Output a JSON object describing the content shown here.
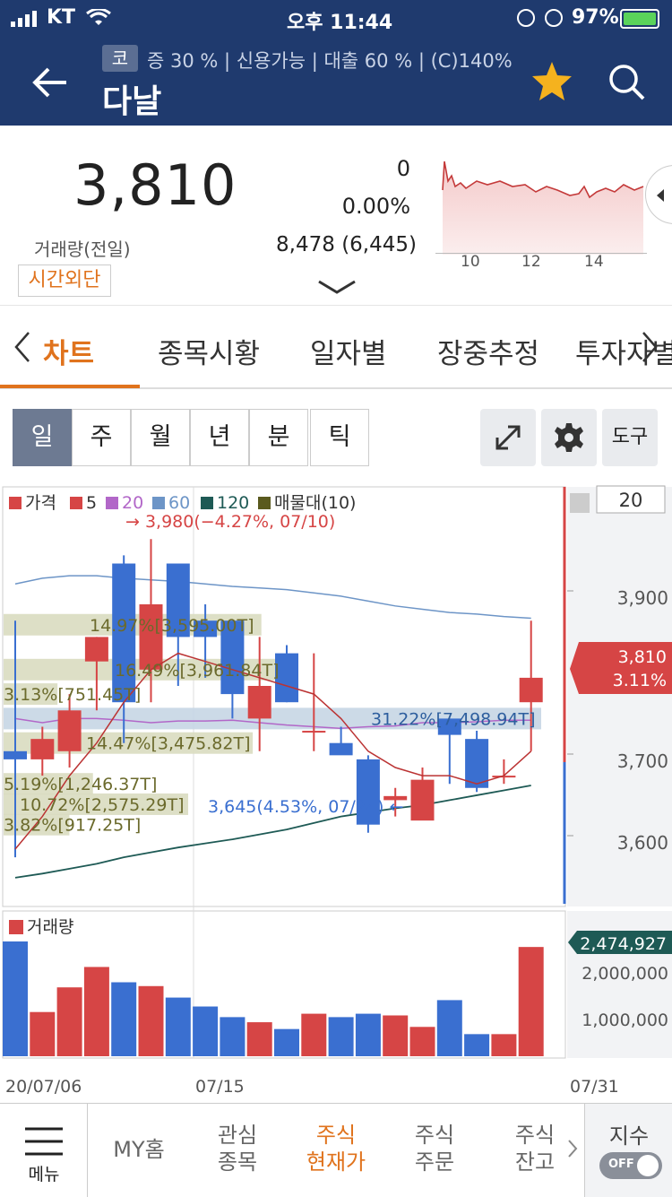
{
  "status": {
    "carrier": "KT",
    "time": "오후 11:44",
    "battery": "97%"
  },
  "header": {
    "badge": "코",
    "margin_info": "증 30 % | 신용가능 | 대출 60 % | (C)140%",
    "title": "다날",
    "back_icon": "arrow-left-icon",
    "star_icon": "star-icon",
    "search_icon": "search-icon"
  },
  "quote": {
    "price": "3,810",
    "change": "0",
    "change_pct": "0.00%",
    "volume_label": "거래량(전일)",
    "volume": "8,478 (6,445)",
    "after_hours": "시간외단",
    "mini_chart_ticks": [
      "10",
      "12",
      "14"
    ]
  },
  "tabs": {
    "prev": "<",
    "items": [
      "차트",
      "종목시황",
      "일자별",
      "장중추정",
      "투자자별"
    ],
    "next": ">"
  },
  "periods": [
    "일",
    "주",
    "월",
    "년",
    "분",
    "틱"
  ],
  "tools": {
    "expand_icon": "expand-icon",
    "gear_icon": "gear-icon",
    "tool_label": "도구"
  },
  "chart_data": {
    "type": "candlestick",
    "legend": [
      "가격",
      "5",
      "20",
      "60",
      "120",
      "매물대(10)"
    ],
    "candles": [
      {
        "o": 3720,
        "h": 3880,
        "l": 3590,
        "c": 3710
      },
      {
        "o": 3710,
        "h": 3750,
        "l": 3690,
        "c": 3735
      },
      {
        "o": 3720,
        "h": 3790,
        "l": 3700,
        "c": 3770
      },
      {
        "o": 3830,
        "h": 3860,
        "l": 3770,
        "c": 3860
      },
      {
        "o": 3950,
        "h": 3960,
        "l": 3730,
        "c": 3780
      },
      {
        "o": 3820,
        "h": 3980,
        "l": 3780,
        "c": 3900
      },
      {
        "o": 3950,
        "h": 3950,
        "l": 3800,
        "c": 3860
      },
      {
        "o": 3880,
        "h": 3900,
        "l": 3810,
        "c": 3860
      },
      {
        "o": 3880,
        "h": 3880,
        "l": 3760,
        "c": 3790
      },
      {
        "o": 3760,
        "h": 3860,
        "l": 3720,
        "c": 3800
      },
      {
        "o": 3840,
        "h": 3850,
        "l": 3780,
        "c": 3780
      },
      {
        "o": 3745,
        "h": 3840,
        "l": 3720,
        "c": 3745
      },
      {
        "o": 3730,
        "h": 3750,
        "l": 3720,
        "c": 3715
      },
      {
        "o": 3710,
        "h": 3715,
        "l": 3620,
        "c": 3630
      },
      {
        "o": 3660,
        "h": 3675,
        "l": 3640,
        "c": 3665
      },
      {
        "o": 3635,
        "h": 3700,
        "l": 3645,
        "c": 3685
      },
      {
        "o": 3760,
        "h": 3760,
        "l": 3680,
        "c": 3740
      },
      {
        "o": 3735,
        "h": 3745,
        "l": 3670,
        "c": 3675
      },
      {
        "o": 3690,
        "h": 3710,
        "l": 3680,
        "c": 3690
      },
      {
        "o": 3780,
        "h": 3880,
        "l": 3720,
        "c": 3810
      }
    ],
    "ma5": [
      3600,
      3640,
      3690,
      3730,
      3780,
      3820,
      3840,
      3830,
      3820,
      3810,
      3800,
      3790,
      3760,
      3720,
      3700,
      3690,
      3690,
      3680,
      3690,
      3720
    ],
    "ma20": [
      3760,
      3755,
      3760,
      3760,
      3758,
      3755,
      3757,
      3757,
      3758,
      3755,
      3752,
      3750,
      3748,
      3750,
      3751,
      3755,
      3755,
      3756,
      3758,
      3758
    ],
    "ma60": [
      3925,
      3932,
      3935,
      3935,
      3932,
      3930,
      3928,
      3925,
      3922,
      3920,
      3918,
      3914,
      3910,
      3904,
      3898,
      3894,
      3890,
      3888,
      3885,
      3883
    ],
    "ma120": [
      3565,
      3570,
      3576,
      3582,
      3590,
      3596,
      3602,
      3607,
      3612,
      3618,
      3624,
      3632,
      3640,
      3645,
      3650,
      3654,
      3660,
      3666,
      3672,
      3678
    ],
    "high_annotation": "→ 3,980(−4.27%, 07/10)",
    "low_annotation": "3,645(4.53%, 07/24) ←",
    "volume_profile": [
      {
        "label": "14.97%[3,595.00T]",
        "price": 3875,
        "pct": 14.97
      },
      {
        "label": "16.49%[3,961.84T]",
        "price": 3820,
        "pct": 16.49
      },
      {
        "label": "3.13%[751.45T]",
        "price": 3790,
        "pct": 3.13
      },
      {
        "label": "31.22%[7,498.94T]",
        "price": 3760,
        "pct": 31.22
      },
      {
        "label": "14.47%[3,475.82T]",
        "price": 3730,
        "pct": 14.47
      },
      {
        "label": "5.19%[1,246.37T]",
        "price": 3680,
        "pct": 5.19
      },
      {
        "label": "10.72%[2,575.29T]",
        "price": 3655,
        "pct": 10.72
      },
      {
        "label": "3.82%[917.25T]",
        "price": 3630,
        "pct": 3.82
      }
    ],
    "y_ticks": [
      "3,900",
      "3,700",
      "3,600"
    ],
    "current_price_tag": "3,810",
    "current_pct_tag": "3.11%",
    "count_box": "20",
    "volume_label": "거래량",
    "volume": [
      2700000,
      1040000,
      1620000,
      2100000,
      1740000,
      1650000,
      1380000,
      1170000,
      920000,
      800000,
      640000,
      1000000,
      920000,
      1000000,
      960000,
      690000,
      1320000,
      520000,
      520000,
      2570000
    ],
    "volume_ticks": [
      "2,000,000",
      "1,000,000"
    ],
    "volume_tag": "2,474,927",
    "x_labels": [
      "20/07/06",
      "07/15",
      "07/31"
    ]
  },
  "bottom_nav": {
    "menu_label": "메뉴",
    "items": [
      "MY홈",
      "관심\n종목",
      "주식\n현재가",
      "주식\n주문",
      "주식\n잔고"
    ],
    "index_label": "지수",
    "toggle": "OFF"
  },
  "colors": {
    "header": "#1f3a6e",
    "up": "#d64545",
    "down": "#3a6fd0",
    "accent": "#e0731d"
  }
}
